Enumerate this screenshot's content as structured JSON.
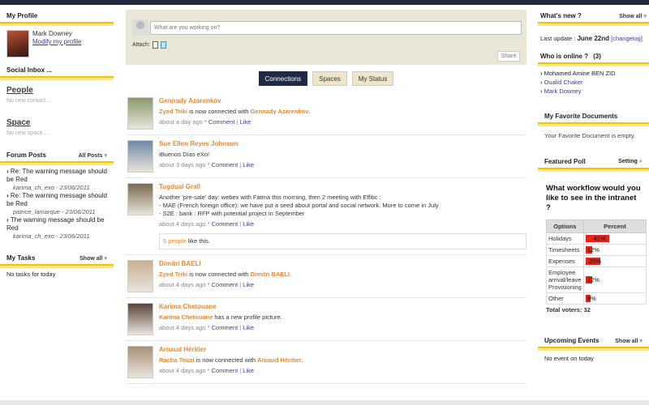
{
  "left": {
    "profile": {
      "title": "My Profile",
      "name": "Mark Downey",
      "modify": "Modify my profile"
    },
    "social": {
      "title": "Social Inbox ...",
      "people": "People",
      "people_empty": "No new contact ...",
      "space": "Space",
      "space_empty": "No new space ..."
    },
    "forum": {
      "title": "Forum Posts",
      "filter": "All Posts",
      "posts": [
        {
          "title": "Re: The warning message should be Red",
          "meta": "karima_ch_exo - 23/06/2011"
        },
        {
          "title": "Re: The warning message should be Red",
          "meta": "patrice_lamarque - 23/06/2011"
        },
        {
          "title": "The warning message should be Red",
          "meta": "karima_ch_exo - 23/06/2011"
        }
      ]
    },
    "tasks": {
      "title": "My Tasks",
      "filter": "Show all",
      "empty": "No tasks for today"
    }
  },
  "composer": {
    "placeholder": "What are you working on?",
    "attach": "Attach:",
    "share": "Share"
  },
  "tabs": [
    "Connections",
    "Spaces",
    "My Status"
  ],
  "activities": [
    {
      "name": "Gennady Azarenkov",
      "a": "Zyed Triki",
      "mid": " is now connected with ",
      "b": "Gennady Azarenkov",
      "end": ".",
      "time": "about a day ago * ",
      "photo": "#8a9a6a"
    },
    {
      "name": "Sue Ellen Reyes Johnson",
      "text": "iBuenos Días eXo!",
      "time": "about 3 days ago * ",
      "photo": "#6f87a6"
    },
    {
      "name": "Tugdual Grall",
      "lines": [
        "Another 'pre-sale' day: webex with Fatma this morning, then 2 meeting with Effitic :",
        "- MAE (French foreign office): we have put a seed about portal and social network. More to come in July",
        "- S2E : bank : RFP with potential project in September"
      ],
      "time": "about 4 days ago * ",
      "likes": "5 people",
      "likes_suffix": " like this.",
      "photo": "#7a6a50"
    },
    {
      "name": "Dimitri BAELI",
      "a": "Zyed Triki",
      "mid": " is now connected with ",
      "b": "Dimitri BAELI",
      "end": ".",
      "time": "about 4 days ago * ",
      "photo": "#c8b090"
    },
    {
      "name": "Karima Chetouane",
      "a": "Karima Chetouane",
      "mid": " has a new profile picture.",
      "time": "about 4 days ago * ",
      "photo": "#5a4438"
    },
    {
      "name": "Arnaud Héritier",
      "a": "Racha Touzi",
      "mid": " is now connected with ",
      "b": "Arnaud Héritier",
      "end": ".",
      "time": "about 4 days ago * ",
      "photo": "#a89078"
    }
  ],
  "meta_links": {
    "comment": "Comment",
    "sep": " | ",
    "like": "Like"
  },
  "right": {
    "whatsnew": {
      "title": "What's new ?",
      "filter": "Show all",
      "label": "Last update : ",
      "date": "June 22nd",
      "changelog": "[changelog]"
    },
    "online": {
      "title": "Who is online ?",
      "count": "(3)",
      "users": [
        "Mohamed Amine BEN ZID",
        "Oualid Chaker",
        "Mark Downey"
      ]
    },
    "docs": {
      "title": "My Favorite Documents",
      "empty": "Your Favorite Document is empty."
    },
    "poll": {
      "title": "Featured Poll",
      "setting": "Setting",
      "question": "What workflow would you like to see in the intranet ?",
      "col_option": "Options",
      "col_percent": "Percent",
      "options": [
        {
          "label": "Holidays",
          "pct": 41,
          "text": "41%"
        },
        {
          "label": "Timesheets",
          "pct": 12,
          "text": "12%"
        },
        {
          "label": "Expenses",
          "pct": 25,
          "text": "25%"
        },
        {
          "label": "Employee arrival/leave Provisioning",
          "pct": 12,
          "text": "12%"
        },
        {
          "label": "Other",
          "pct": 8,
          "text": "8%"
        }
      ],
      "total": "Total voters: 32"
    },
    "events": {
      "title": "Upcoming Events",
      "filter": "Show all",
      "empty": "No event on today"
    }
  },
  "colors": {
    "accent": "#f5c400",
    "name": "#f0872b",
    "link": "#3b3b9a",
    "nav": "#1f2a44"
  }
}
